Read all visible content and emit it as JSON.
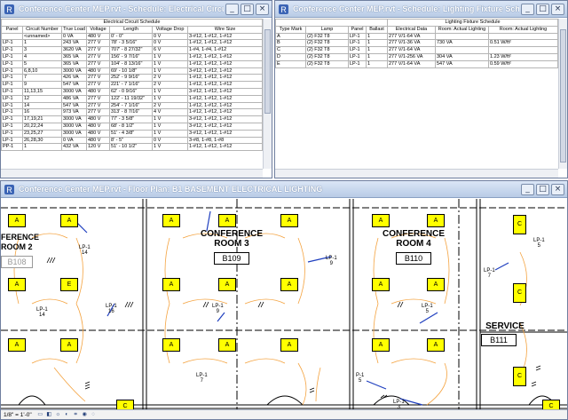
{
  "circuit_window": {
    "title": "Conference Center MEP.rvt - Schedule: Electrical Circuit Sc...",
    "group_header": "Electrical Circuit Schedule",
    "columns": [
      "Panel",
      "Circuit Number",
      "True Load",
      "Voltage",
      "Length",
      "Voltage Drop",
      "Wire Size"
    ],
    "rows": [
      [
        "",
        "<unnamed>",
        "0 VA",
        "480 V",
        "0' - 0\"",
        "0 V",
        "3-#12, 1-#12, 1-#12"
      ],
      [
        "LP-1",
        "1",
        "243 VA",
        "277 V",
        "78' - 3 5/16\"",
        "0 V",
        "1-#12, 1-#12, 1-#12"
      ],
      [
        "LP-1",
        "3",
        "3620 VA",
        "277 V",
        "707' - 8 27/32\"",
        "6 V",
        "1-#4, 1-#4, 1-#12"
      ],
      [
        "LP-1",
        "4",
        "365 VA",
        "277 V",
        "156' - 9 7/16\"",
        "1 V",
        "1-#12, 1-#12, 1-#12"
      ],
      [
        "LP-1",
        "5",
        "365 VA",
        "277 V",
        "104' - 8 13/16\"",
        "1 V",
        "1-#12, 1-#12, 1-#12"
      ],
      [
        "LP-1",
        "6,8,10",
        "3000 VA",
        "480 V",
        "69' - 10 1/8\"",
        "1 V",
        "3-#12, 1-#12, 1-#12"
      ],
      [
        "LP-1",
        "7",
        "426 VA",
        "277 V",
        "252' - 9 9/16\"",
        "2 V",
        "1-#12, 1-#12, 1-#12"
      ],
      [
        "LP-1",
        "9",
        "547 VA",
        "277 V",
        "221' - 7 1/16\"",
        "2 V",
        "1-#12, 1-#12, 1-#12"
      ],
      [
        "LP-1",
        "11,13,15",
        "3000 VA",
        "480 V",
        "62' - 0 9/16\"",
        "1 V",
        "3-#12, 1-#12, 1-#12"
      ],
      [
        "LP-1",
        "12",
        "486 VA",
        "277 V",
        "122' - 11 19/32\"",
        "1 V",
        "1-#12, 1-#12, 1-#12"
      ],
      [
        "LP-1",
        "14",
        "547 VA",
        "277 V",
        "254' - 7 1/16\"",
        "2 V",
        "1-#12, 1-#12, 1-#12"
      ],
      [
        "LP-1",
        "16",
        "973 VA",
        "277 V",
        "313' - 8 7/16\"",
        "4 V",
        "1-#12, 1-#12, 1-#12"
      ],
      [
        "LP-1",
        "17,19,21",
        "3000 VA",
        "480 V",
        "77' - 3 5/8\"",
        "1 V",
        "3-#12, 1-#12, 1-#12"
      ],
      [
        "LP-1",
        "20,22,24",
        "3000 VA",
        "480 V",
        "68' - 8 1/2\"",
        "1 V",
        "3-#12, 1-#12, 1-#12"
      ],
      [
        "LP-1",
        "23,25,27",
        "3000 VA",
        "480 V",
        "51' - 4 3/8\"",
        "1 V",
        "3-#12, 1-#12, 1-#12"
      ],
      [
        "LP-1",
        "26,28,30",
        "0 VA",
        "480 V",
        "8' - 5\"",
        "0 V",
        "3-#8, 1-#8, 1-#8"
      ],
      [
        "PP-1",
        "1",
        "432 VA",
        "120 V",
        "51' - 10 1/2\"",
        "1 V",
        "1-#12, 1-#12, 1-#12"
      ]
    ]
  },
  "fixture_window": {
    "title": "Conference Center MEP.rvt - Schedule: Lighting Fixture Schedule",
    "group_header": "Lighting Fixture Schedule",
    "columns": [
      "Type Mark",
      "Lamp",
      "Panel",
      "Ballast",
      "Electrical Data",
      "Room: Actual Lighting",
      "Room: Actual Lighting"
    ],
    "rows": [
      [
        "A",
        "(2) F32 T8",
        "LP-1",
        "1",
        "277 V/1-64 VA",
        "",
        ""
      ],
      [
        "B",
        "(2) F32 T8",
        "LP-1",
        "1",
        "277 V/1-36 VA",
        "730 VA",
        "0.51 W/ft²"
      ],
      [
        "C",
        "(2) F32 T8",
        "LP-1",
        "1",
        "277 V/1-64 VA",
        "",
        ""
      ],
      [
        "D",
        "(2) F32 T8",
        "LP-1",
        "1",
        "277 V/1-256 VA",
        "304 VA",
        "1.23 W/ft²"
      ],
      [
        "E",
        "(2) F32 T8",
        "LP-1",
        "1",
        "277 V/1-64 VA",
        "547 VA",
        "0.59 W/ft²"
      ]
    ]
  },
  "plan_window": {
    "title": "Conference Center MEP.rvt - Floor Plan: B1 BASEMENT ELECTRICAL LIGHTING",
    "rooms": [
      {
        "name_line1": "FERENCE",
        "name_line2": "ROOM 2",
        "number": "B108"
      },
      {
        "name_line1": "CONFERENCE",
        "name_line2": "ROOM 3",
        "number": "B109"
      },
      {
        "name_line1": "CONFERENCE",
        "name_line2": "ROOM 4",
        "number": "B110"
      },
      {
        "name_line1": "SERVICE",
        "name_line2": "",
        "number": "B111"
      }
    ],
    "fixture_labels": {
      "a": "A",
      "c": "C",
      "e": "E"
    },
    "circuit_tags": {
      "t1": {
        "panel": "LP-1",
        "circuit": "14"
      },
      "t2": {
        "panel": "LP-1",
        "circuit": "14"
      },
      "t3": {
        "panel": "LP-1",
        "circuit": "16"
      },
      "t4": {
        "panel": "LP-1",
        "circuit": "9"
      },
      "t5": {
        "panel": "LP-1",
        "circuit": "9"
      },
      "t6": {
        "panel": "LP-1",
        "circuit": "5"
      },
      "t7": {
        "panel": "LP-1",
        "circuit": "5"
      },
      "t8": {
        "panel": "LP-1",
        "circuit": "7"
      },
      "t9": {
        "panel": "LP-1",
        "circuit": "7"
      },
      "t10": {
        "panel": "P-1",
        "circuit": "5"
      },
      "t11": {
        "panel": "LP-1",
        "circuit": "3"
      }
    },
    "status_scale": "1/8\" = 1'-0\""
  },
  "window_buttons": {
    "minimize": "_",
    "maximize": "□",
    "close": "×"
  },
  "colors": {
    "fixture": "#ffff00",
    "wire": "#f4a340",
    "tag_line": "#1f3fbf",
    "titlebar": "#b8cbe6"
  }
}
